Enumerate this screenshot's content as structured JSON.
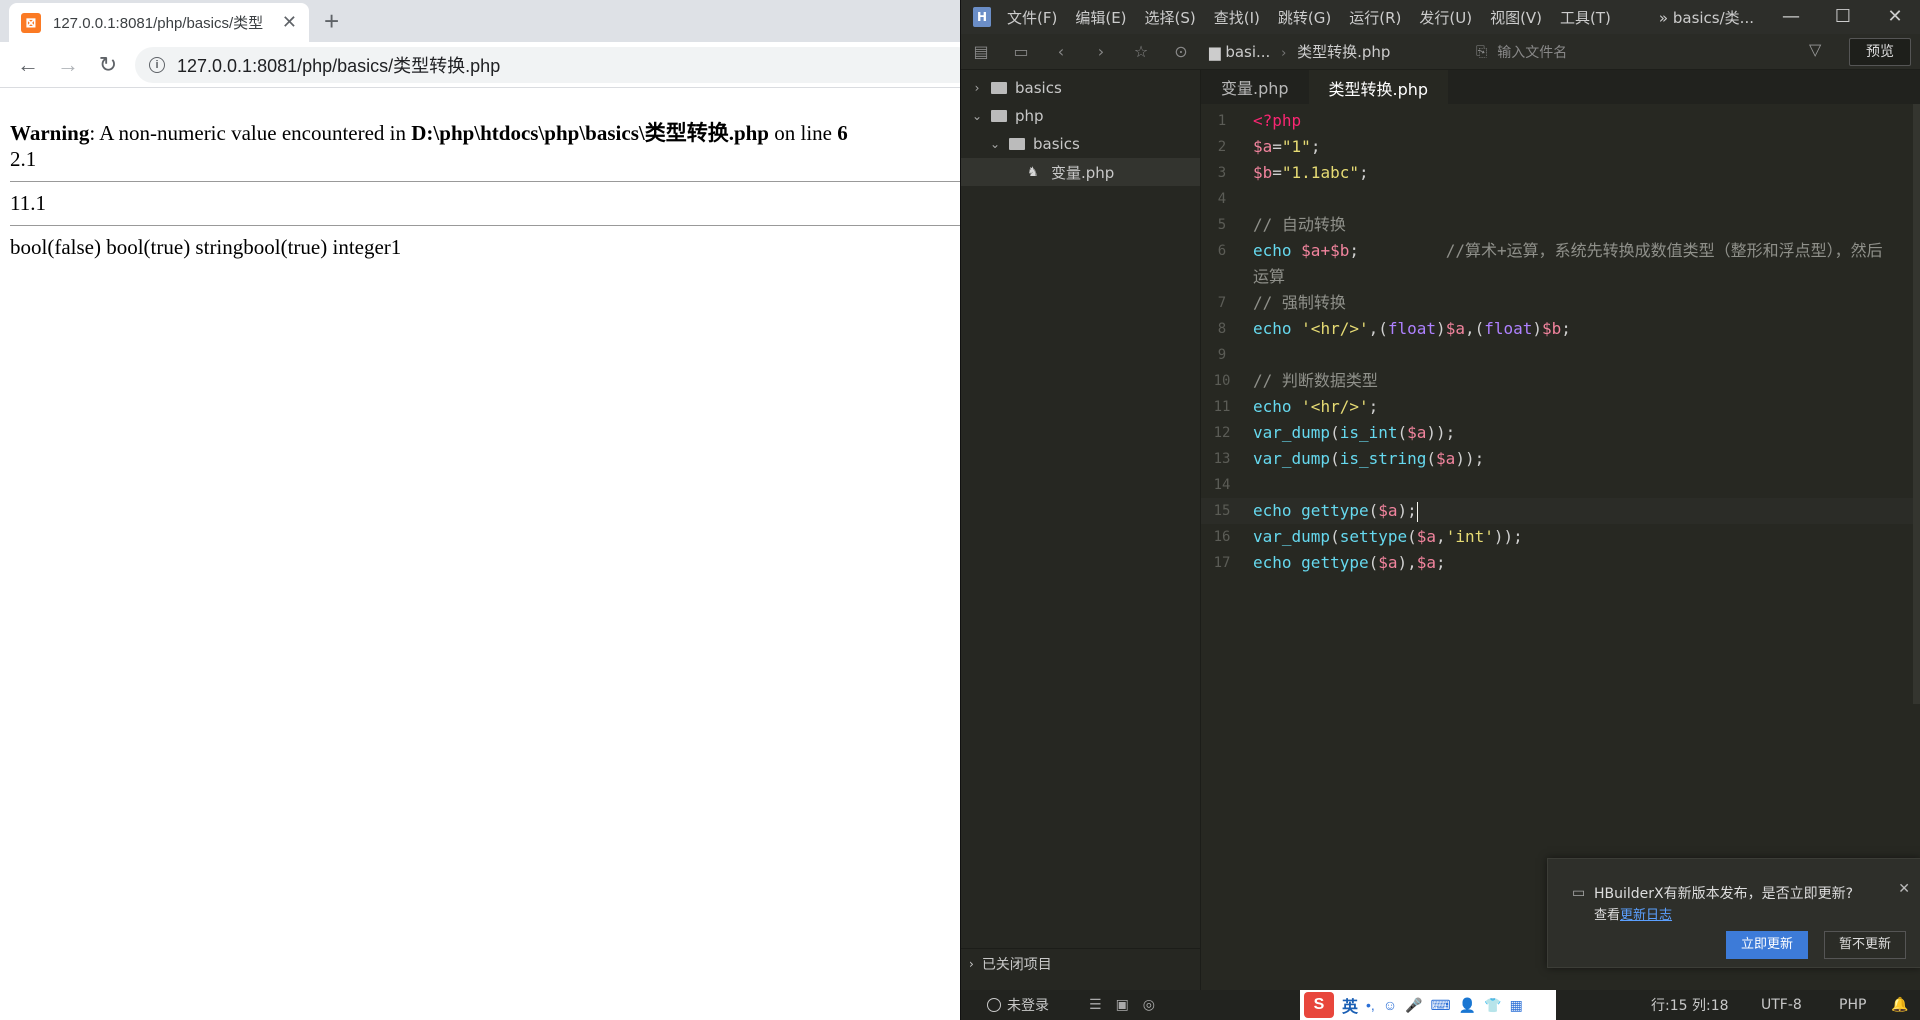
{
  "browser": {
    "tab_title": "127.0.0.1:8081/php/basics/类型",
    "url": "127.0.0.1:8081/php/basics/类型转换.php",
    "page": {
      "warning_label": "Warning",
      "warning_text": ": A non-numeric value encountered in ",
      "warning_path": "D:\\php\\htdocs\\php\\basics\\类型转换.php",
      "warning_online": " on line ",
      "warning_line": "6",
      "output1": "2.1",
      "output2": "11.1",
      "output3": "bool(false) bool(true) stringbool(true) integer1"
    }
  },
  "ide": {
    "menu": [
      "文件(F)",
      "编辑(E)",
      "选择(S)",
      "查找(I)",
      "跳转(G)",
      "运行(R)",
      "发行(U)",
      "视图(V)",
      "工具(T)"
    ],
    "title_crumb": "basics/类...",
    "breadcrumb": {
      "folder": "basi...",
      "file": "类型转换.php"
    },
    "search_placeholder": "输入文件名",
    "preview_label": "预览",
    "tree": [
      {
        "label": "basics",
        "chev": "›"
      },
      {
        "label": "php",
        "chev": "⌄"
      },
      {
        "label": "basics",
        "chev": "⌄"
      },
      {
        "label": "变量.php",
        "chev": ""
      }
    ],
    "closed_projects": "已关闭项目",
    "tabs": [
      "变量.php",
      "类型转换.php"
    ],
    "line_numbers": [
      "1",
      "2",
      "3",
      "4",
      "5",
      "6",
      "7",
      "8",
      "9",
      "10",
      "11",
      "12",
      "13",
      "14",
      "15",
      "16",
      "17"
    ],
    "code": {
      "l1": "<?php",
      "l2_var": "$a",
      "l2_rest": "=",
      "l2_str": "\"1\"",
      "l2_end": ";",
      "l3_var": "$b",
      "l3_rest": "=",
      "l3_str": "\"1.1abc\"",
      "l3_end": ";",
      "l5": "// 自动转换",
      "l6_kw": "echo ",
      "l6_a": "$a",
      "l6_op": "+",
      "l6_b": "$b",
      "l6_end": ";",
      "l6_comment": "//算术+运算，系统先转换成数值类型（整形和浮点型），然后运算",
      "l7": "// 强制转换",
      "l8_kw": "echo ",
      "l8_str": "'<hr/>'",
      "l8_c1": ",(",
      "l8_f1": "float",
      "l8_c2": ")",
      "l8_a": "$a",
      "l8_c3": ",(",
      "l8_f2": "float",
      "l8_c4": ")",
      "l8_b": "$b",
      "l8_end": ";",
      "l10": "// 判断数据类型",
      "l11_kw": "echo ",
      "l11_str": "'<hr/>'",
      "l11_end": ";",
      "l12_fn": "var_dump",
      "l12_p1": "(",
      "l12_fn2": "is_int",
      "l12_p2": "(",
      "l12_a": "$a",
      "l12_end": "));",
      "l13_fn": "var_dump",
      "l13_p1": "(",
      "l13_fn2": "is_string",
      "l13_p2": "(",
      "l13_a": "$a",
      "l13_end": "));",
      "l15_kw": "echo ",
      "l15_fn": "gettype",
      "l15_p": "(",
      "l15_a": "$a",
      "l15_end": ");",
      "l16_fn": "var_dump",
      "l16_p1": "(",
      "l16_fn2": "settype",
      "l16_p2": "(",
      "l16_a": "$a",
      "l16_c": ",",
      "l16_str": "'int'",
      "l16_end": "));",
      "l17_kw": "echo ",
      "l17_fn": "gettype",
      "l17_p": "(",
      "l17_a": "$a",
      "l17_c": "),",
      "l17_a2": "$a",
      "l17_end": ";"
    },
    "notification": {
      "message": "HBuilderX有新版本发布，是否立即更新?",
      "view_prefix": "查看",
      "view_link": "更新日志",
      "update_now": "立即更新",
      "later": "暂不更新"
    },
    "status": {
      "login": "未登录",
      "position": "行:15  列:18",
      "encoding": "UTF-8",
      "language": "PHP"
    }
  },
  "ime": {
    "mode": "英"
  }
}
